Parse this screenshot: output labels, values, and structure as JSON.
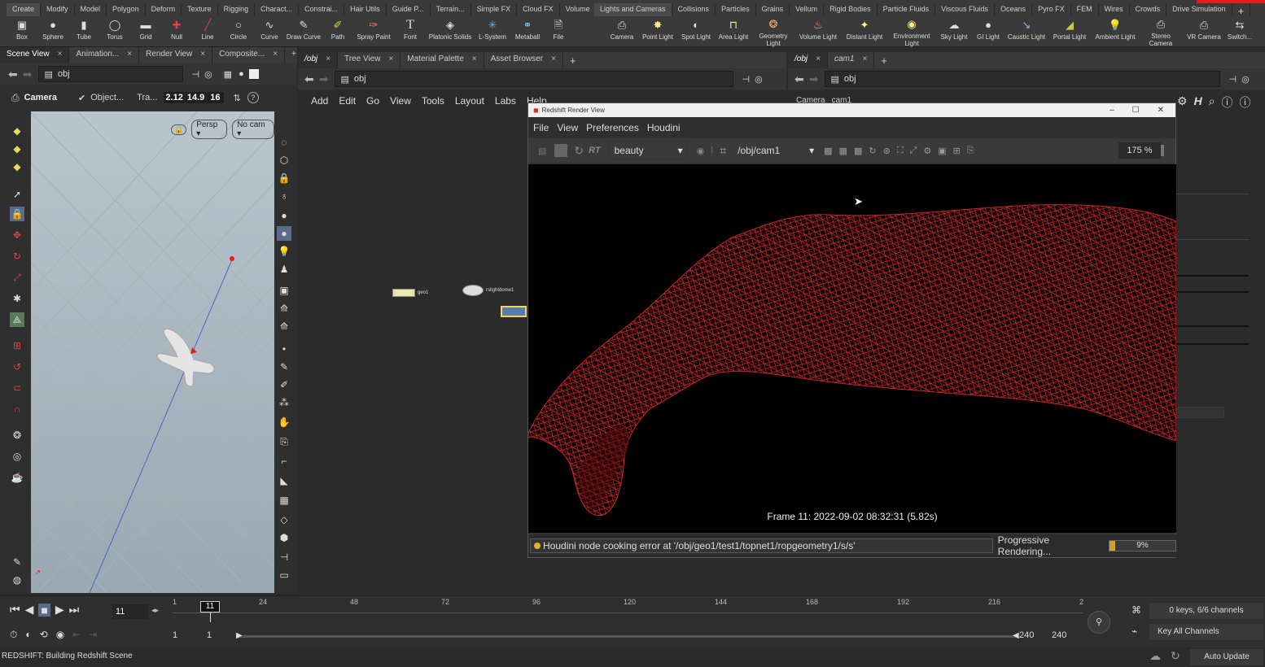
{
  "shelf": {
    "left_tabs": [
      "Create",
      "Modify",
      "Model",
      "Polygon",
      "Deform",
      "Texture",
      "Rigging",
      "Charact...",
      "Constrai...",
      "Hair Utils",
      "Guide P...",
      "Terrain...",
      "Simple FX",
      "Cloud FX",
      "Volume"
    ],
    "right_tabs": [
      "Lights and Cameras",
      "Collisions",
      "Particles",
      "Grains",
      "Vellum",
      "Rigid Bodies",
      "Particle Fluids",
      "Viscous Fluids",
      "Oceans",
      "Pyro FX",
      "FEM",
      "Wires",
      "Crowds",
      "Drive Simulation"
    ],
    "left_tools": [
      "Box",
      "Sphere",
      "Tube",
      "Torus",
      "Grid",
      "Null",
      "Line",
      "Circle",
      "Curve",
      "Draw Curve",
      "Path",
      "Spray Paint",
      "Font",
      "Platonic Solids",
      "L-System",
      "Metaball",
      "File"
    ],
    "right_tools": [
      "Camera",
      "Point Light",
      "Spot Light",
      "Area Light",
      "Geometry Light",
      "Volume Light",
      "Distant Light",
      "Environment Light",
      "Sky Light",
      "GI Light",
      "Caustic Light",
      "Portal Light",
      "Ambient Light",
      "Stereo Camera",
      "VR Camera",
      "Switch..."
    ]
  },
  "left_pane": {
    "tabs": [
      "Scene View",
      "Animation...",
      "Render View",
      "Composite..."
    ],
    "path": "obj",
    "camera_label": "Camera",
    "object_label": "Object...",
    "tra_label": "Tra...",
    "tra_values": [
      "2.12",
      "14.9",
      "16"
    ],
    "persp_label": "Persp",
    "nocam_label": "No cam"
  },
  "mid_pane": {
    "tabs": [
      "/obj",
      "Tree View",
      "Material Palette",
      "Asset Browser"
    ],
    "path": "obj",
    "menu": [
      "Add",
      "Edit",
      "Go",
      "View",
      "Tools",
      "Layout",
      "Labs",
      "Help"
    ],
    "nodes": [
      "geo1",
      "rslightdome1"
    ]
  },
  "right_pane": {
    "tabs": [
      "/obj",
      "cam1"
    ],
    "path": "obj",
    "param_label": "Camera",
    "param_value": "cam1"
  },
  "render_view": {
    "title": "Redshift Render View",
    "menu": [
      "File",
      "View",
      "Preferences",
      "Houdini"
    ],
    "rt_label": "RT",
    "aov": "beauty",
    "camera": "/obj/cam1",
    "zoom": "175 %",
    "frame_info": "Frame 11: 2022-09-02 08:32:31 (5.82s)",
    "error_message": "Houdini node cooking error at '/obj/geo1/test1/topnet1/ropgeometry1/s/s'",
    "progress_label": "Progressive Rendering...",
    "progress_value": "9%",
    "progress_fraction": 0.09
  },
  "timeline": {
    "current_frame": "11",
    "frame_marker": "11",
    "ticks": [
      "1",
      "24",
      "48",
      "72",
      "96",
      "120",
      "144",
      "168",
      "192",
      "216",
      "2"
    ],
    "range_start": "1",
    "range_start2": "1",
    "range_end": "240",
    "range_end2": "240",
    "keys_info": "0 keys, 6/6 channels",
    "key_all": "Key All Channels",
    "auto_update": "Auto Update"
  },
  "status": {
    "message": "REDSHIFT: Building Redshift Scene"
  },
  "colors": {
    "accent_red": "#e02020",
    "mesh_red": "#d02a2a",
    "progress_fill": "#d4a020"
  }
}
